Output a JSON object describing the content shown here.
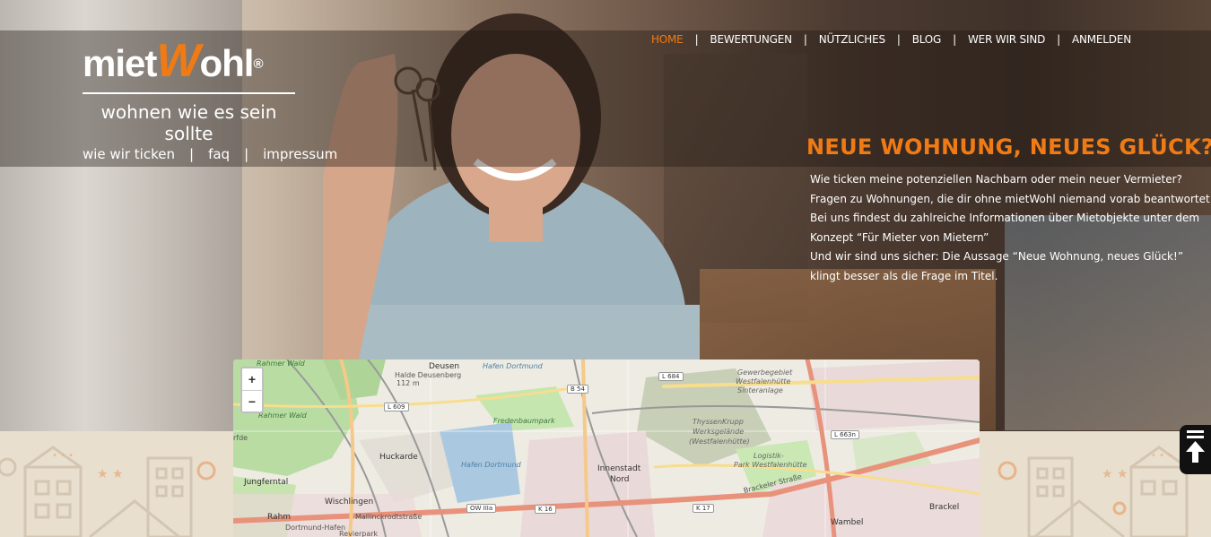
{
  "brand": {
    "name_part1": "miet",
    "name_w": "W",
    "name_part2": "ohl",
    "registered": "®",
    "tagline": "wohnen wie es sein sollte"
  },
  "subnav": [
    {
      "label": "wie wir ticken"
    },
    {
      "label": "faq"
    },
    {
      "label": "impressum"
    }
  ],
  "mainnav": [
    {
      "label": "HOME",
      "active": true
    },
    {
      "label": "BEWERTUNGEN"
    },
    {
      "label": "NÜTZLICHES"
    },
    {
      "label": "BLOG"
    },
    {
      "label": "WER WIR SIND"
    },
    {
      "label": "ANMELDEN"
    }
  ],
  "separator": "|",
  "hero": {
    "title": "NEUE WOHNUNG, NEUES GLÜCK?",
    "lines": [
      "Wie ticken meine potenziellen Nachbarn oder mein neuer Vermieter?",
      "Fragen zu Wohnungen, die dir ohne mietWohl niemand vorab beantwortet.",
      "Bei uns findest du zahlreiche Informationen über Mietobjekte unter dem",
      "Konzept “Für Mieter von Mietern”",
      "Und wir sind uns sicher: Die Aussage “Neue Wohnung, neues Glück!”",
      "klingt besser als die Frage im Titel."
    ]
  },
  "map": {
    "zoom_in": "+",
    "zoom_out": "−",
    "labels": {
      "deusen": "Deusen",
      "halle_deusenberg": "Halde Deusenberg",
      "halle_elev": "112 m",
      "hafen_dortmund_top": "Hafen Dortmund",
      "rahmer_wald_top": "Rahmer Wald",
      "rahmer_wald": "Rahmer Wald",
      "fredenbaumpark": "Fredenbaumpark",
      "huckarde": "Huckarde",
      "jungferntal": "Jungferntal",
      "wischlingen": "Wischlingen",
      "rahm": "Rahm",
      "hafen_dortmund": "Hafen Dortmund",
      "innenstadt_nord_1": "Innenstadt",
      "innenstadt_nord_2": "Nord",
      "thyssenkrupp_1": "ThyssenKrupp",
      "thyssenkrupp_2": "Werksgelände",
      "thyssenkrupp_3": "(Westfalenhütte)",
      "gewerbegebiet_1": "Gewerbegebiet",
      "gewerbegebiet_2": "Westfalenhütte",
      "gewerbegebiet_3": "Sinteranlage",
      "logistik_1": "Logistik-",
      "logistik_2": "Park Westfalenhütte",
      "brackel": "Brackel",
      "wambel": "Wambel",
      "mallinckrodtstr": "Mallinckrodtstraße",
      "brackeler_str": "Brackeler Straße",
      "dortmund_hafen": "Dortmund-Hafen",
      "revierpark": "Revierpark",
      "erfde": "rfde"
    },
    "badges": {
      "l609": "L 609",
      "b54": "B 54",
      "l684": "L 684",
      "l663n": "L 663n",
      "ow3a": "OW IIIa",
      "k16": "K 16",
      "k17": "K 17"
    }
  }
}
